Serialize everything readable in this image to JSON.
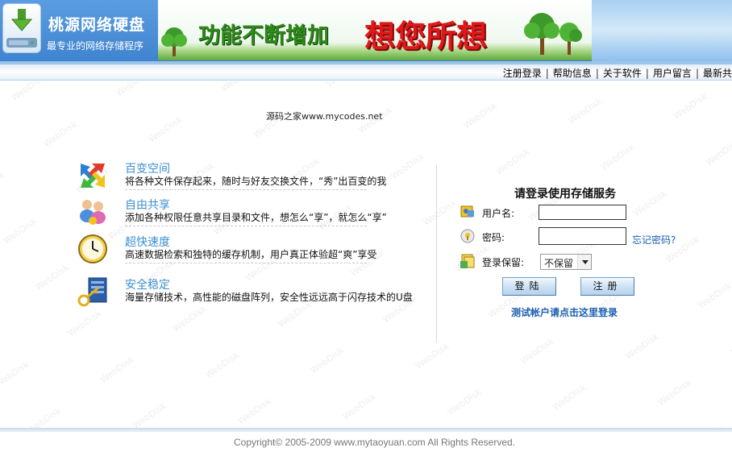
{
  "header": {
    "logo_title": "桃源网络硬盘",
    "logo_subtitle": "最专业的网络存储程序",
    "banner_text1": "功能不断增加",
    "banner_text2": "想您所想"
  },
  "nav": {
    "items": [
      "注册登录",
      "帮助信息",
      "关于软件",
      "用户留言",
      "最新共"
    ],
    "separator": "|"
  },
  "watermark_text": "WebDisk",
  "site_note": "源码之家www.mycodes.net",
  "features": [
    {
      "icon": "arrows-icon",
      "title": "百变空间",
      "desc": "将各种文件保存起来，随时与好友交换文件，“秀”出百变的我"
    },
    {
      "icon": "users-icon",
      "title": "自由共享",
      "desc": "添加各种权限任意共享目录和文件，想怎么“享”，就怎么“享”"
    },
    {
      "icon": "clock-icon",
      "title": "超快速度",
      "desc": "高速数据检索和独特的缓存机制，用户真正体验超“爽”享受"
    },
    {
      "icon": "key-icon",
      "title": "安全稳定",
      "desc": "海量存储技术，高性能的磁盘阵列，安全性远远高于闪存技术的U盘"
    }
  ],
  "login": {
    "title": "请登录使用存储服务",
    "username_label": "用户名:",
    "username_value": "",
    "password_label": "密码:",
    "password_value": "",
    "forgot_link": "忘记密码?",
    "keep_label": "登录保留:",
    "keep_value": "不保留",
    "login_button": "登陆",
    "register_button": "注册",
    "test_link": "测试帐户请点击这里登录"
  },
  "footer": {
    "copyright": "Copyright© 2005-2009 www.mytaoyuan.com All Rights Reserved."
  },
  "colors": {
    "header_blue": "#4a8fd6",
    "feature_title": "#3b8fd1",
    "link_blue": "#1a5fb0",
    "banner_red": "#e01818",
    "banner_green": "#2f8a1b"
  }
}
